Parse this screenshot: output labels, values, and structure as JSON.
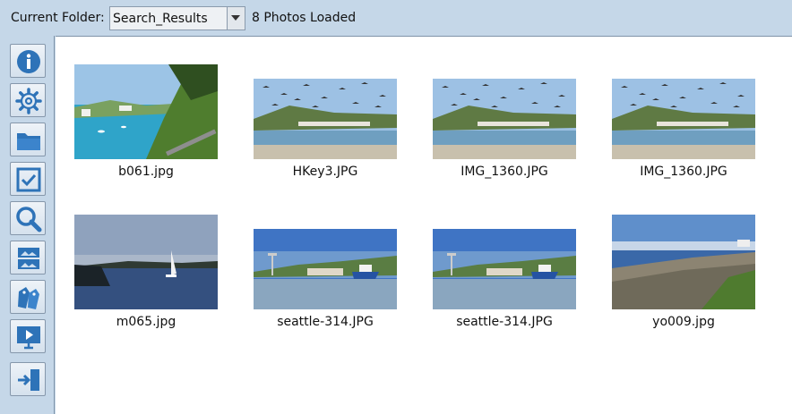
{
  "toolbar": {
    "folder_label": "Current Folder:",
    "folder_value": "Search_Results",
    "status": "8 Photos Loaded"
  },
  "sidebar": {
    "buttons": [
      {
        "icon": "info-icon"
      },
      {
        "icon": "gear-icon"
      },
      {
        "icon": "folder-icon"
      },
      {
        "icon": "checkbox-icon"
      },
      {
        "icon": "magnifier-icon"
      },
      {
        "icon": "photo-slides-icon"
      },
      {
        "icon": "tags-icon"
      },
      {
        "icon": "slideshow-icon"
      },
      {
        "icon": "exit-door-icon"
      }
    ]
  },
  "photos": [
    {
      "name": "b061.jpg",
      "scene": "tropical-shore"
    },
    {
      "name": "HKey3.JPG",
      "scene": "birds-beach"
    },
    {
      "name": "IMG_1360.JPG",
      "scene": "birds-beach"
    },
    {
      "name": "IMG_1360.JPG",
      "scene": "birds-beach"
    },
    {
      "name": "m065.jpg",
      "scene": "sailboat"
    },
    {
      "name": "seattle-314.JPG",
      "scene": "harbor"
    },
    {
      "name": "seattle-314.JPG",
      "scene": "harbor"
    },
    {
      "name": "yo009.jpg",
      "scene": "rocky-coast"
    }
  ]
}
